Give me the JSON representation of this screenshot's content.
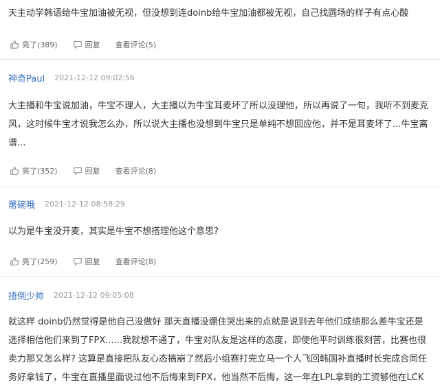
{
  "comments": [
    {
      "content": "天主动学韩语给牛宝加油被无视，但没想到连doinb给牛宝加油都被无视，自己找圆场的样子有点心酸",
      "like_label": "亮了(389)",
      "reply_label": "回复",
      "view_label": "查看评论(5)"
    },
    {
      "author": "神奇Paul",
      "time": "2021-12-12 09:02:56",
      "content": "大主播和牛宝说加油，牛宝不理人，大主播以为牛宝耳麦坏了所以没理他，所以再说了一句，我听不到麦克风，这时候牛宝才说我怎么办，所以说大主播也没想到牛宝只是单纯不想回应他，并不是耳麦坏了...牛宝离谱...",
      "like_label": "亮了(352)",
      "reply_label": "回复",
      "view_label": "查看评论(8)"
    },
    {
      "author": "屠碗哦",
      "time": "2021-12-12 08:58:29",
      "content": "以为是牛宝没开麦，其实是牛宝不想搭理他这个意思?",
      "like_label": "亮了(259)",
      "reply_label": "回复",
      "view_label": "查看评论(8)"
    },
    {
      "author": "捂倒少帅",
      "time": "2021-12-12 09:05:08",
      "content": "就这样 doinb仍然觉得是他自己没做好  那天直播没绷住哭出来的点就是说到去年他们成绩那么差牛宝还是选择相信他们来到了FPX......我就想不通了，牛宝对队友是这样的态度，即使他平时训练很刻苦，比赛也很卖力那又怎么样? 这算是直接把队友心态搞崩了然后小组赛打完立马一个人飞回韩国补直播时长完成合同任务好拿钱了，牛宝在直播里面说过他不后悔来到FPX，他当然不后悔，这一年在LPL拿到的工资够他在LCK打三年的"
    }
  ],
  "icons": {
    "like": "thumbs-up-icon",
    "reply": "speech-bubble-icon",
    "view": "eye-icon"
  },
  "colors": {
    "author": "#3a6fbf",
    "text": "#333333",
    "meta": "#9a9a9a",
    "divider": "#e6e6e6"
  }
}
